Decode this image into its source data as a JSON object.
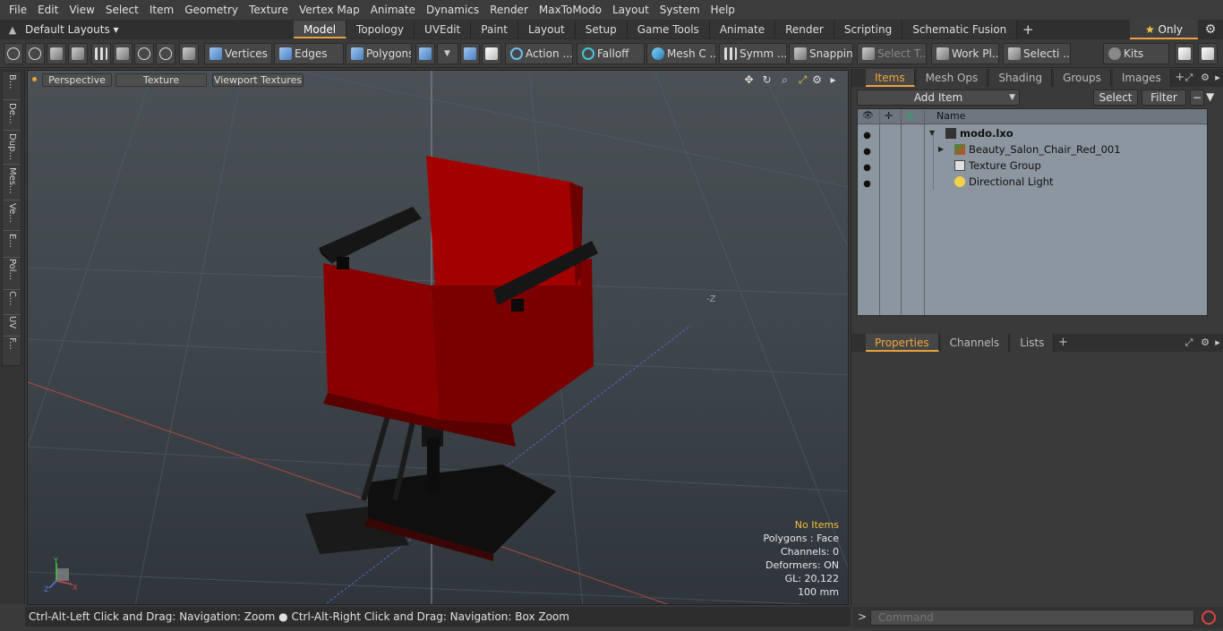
{
  "menu": [
    "File",
    "Edit",
    "View",
    "Select",
    "Item",
    "Geometry",
    "Texture",
    "Vertex Map",
    "Animate",
    "Dynamics",
    "Render",
    "MaxToModo",
    "Layout",
    "System",
    "Help"
  ],
  "layout": {
    "default_layouts": "Default Layouts ▾",
    "tabs": [
      "Model",
      "Topology",
      "UVEdit",
      "Paint",
      "Layout",
      "Setup",
      "Game Tools",
      "Animate",
      "Render",
      "Scripting",
      "Schematic Fusion"
    ],
    "active_tab": "Model",
    "add_tab": "+",
    "only_star": "★",
    "only_label": "Only"
  },
  "toolbar": {
    "vertices": "Vertices",
    "edges": "Edges",
    "polygons": "Polygons",
    "action": "Action ...",
    "falloff": "Falloff",
    "mesh_c": "Mesh C ...",
    "symm": "Symm ...",
    "snapping": "Snapping",
    "select_t": "Select T...",
    "work_pl": "Work Pl...",
    "selecti": "Selecti ...",
    "kits": "Kits"
  },
  "left_strip": [
    "B...",
    "De...",
    "Dup...",
    "Mes...",
    "Ve...",
    "E...",
    "Pol...",
    "C...",
    "UV",
    "F..."
  ],
  "viewport": {
    "perspective": "Perspective",
    "texture": "Texture",
    "viewport_textures": "Viewport Textures",
    "axis_label_neg_z": "-Z",
    "info": {
      "no_items": "No Items",
      "polygons": "Polygons : Face",
      "channels": "Channels: 0",
      "deformers": "Deformers: ON",
      "gl": "GL: 20,122",
      "scale": "100 mm"
    },
    "gizmo": {
      "y": "Y",
      "z": "Z",
      "x": "X"
    }
  },
  "status": "Ctrl-Alt-Left Click and Drag: Navigation: Zoom ● Ctrl-Alt-Right Click and Drag: Navigation: Box Zoom",
  "command": {
    "arrow": ">",
    "placeholder": "Command"
  },
  "items_panel": {
    "tabs": [
      "Items",
      "Mesh Ops",
      "Shading",
      "Groups",
      "Images"
    ],
    "active": "Items",
    "add_item": "Add Item",
    "select": "Select",
    "filter": "Filter",
    "name_header": "Name",
    "rows": [
      {
        "label": "modo.lxo",
        "bold": true
      },
      {
        "label": "Beauty_Salon_Chair_Red_001"
      },
      {
        "label": "Texture Group"
      },
      {
        "label": "Directional Light"
      }
    ]
  },
  "props_panel": {
    "tabs": [
      "Properties",
      "Channels",
      "Lists"
    ],
    "active": "Properties"
  }
}
